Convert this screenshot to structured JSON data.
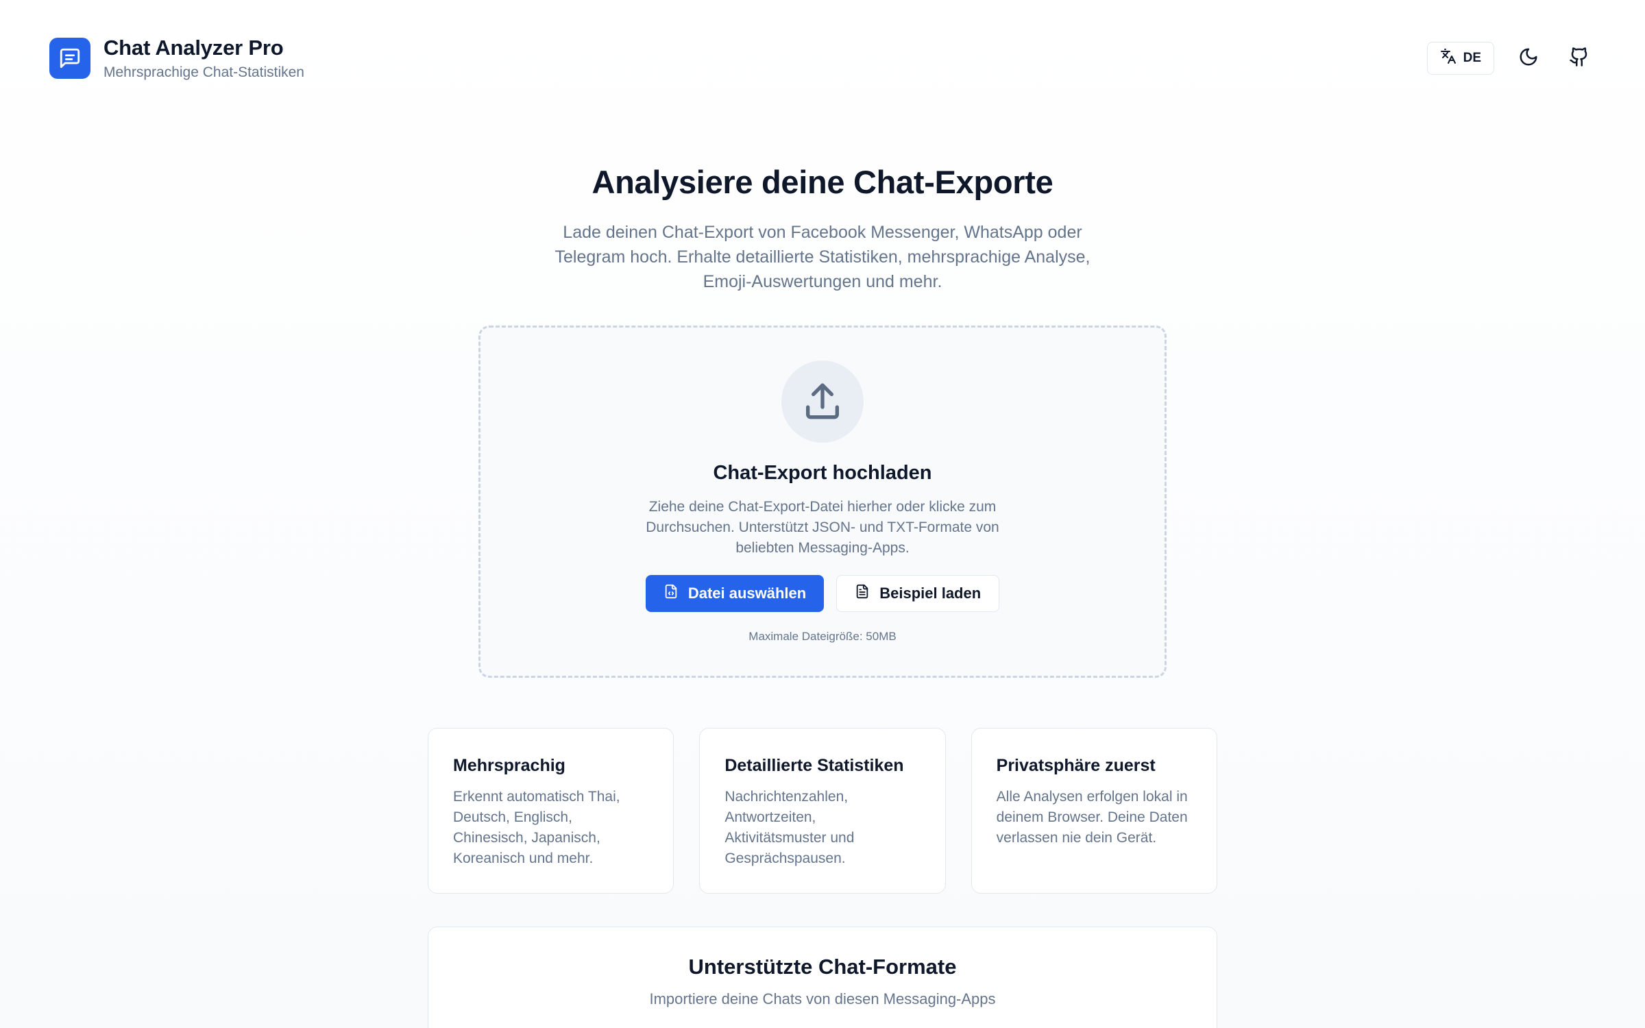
{
  "header": {
    "title": "Chat Analyzer Pro",
    "subtitle": "Mehrsprachige Chat-Statistiken",
    "language_label": "DE",
    "logo_icon": "message-square-icon",
    "language_icon": "translate-icon",
    "theme_icon": "moon-icon",
    "repo_icon": "github-icon"
  },
  "hero": {
    "title": "Analysiere deine Chat-Exporte",
    "description": "Lade deinen Chat-Export von Facebook Messenger, WhatsApp oder Telegram hoch. Erhalte detaillierte Statistiken, mehrsprachige Analyse, Emoji-Auswertungen und mehr."
  },
  "upload": {
    "icon": "upload-icon",
    "title": "Chat-Export hochladen",
    "description": "Ziehe deine Chat-Export-Datei hierher oder klicke zum Durchsuchen. Unterstützt JSON- und TXT-Formate von beliebten Messaging-Apps.",
    "choose_file_label": "Datei auswählen",
    "load_example_label": "Beispiel laden",
    "max_size_note": "Maximale Dateigröße: 50MB"
  },
  "features": [
    {
      "title": "Mehrsprachig",
      "description": "Erkennt automatisch Thai, Deutsch, Englisch, Chinesisch, Japanisch, Koreanisch und mehr."
    },
    {
      "title": "Detaillierte Statistiken",
      "description": "Nachrichtenzahlen, Antwortzeiten, Aktivitätsmuster und Gesprächspausen."
    },
    {
      "title": "Privatsphäre zuerst",
      "description": "Alle Analysen erfolgen lokal in deinem Browser. Deine Daten verlassen nie dein Gerät."
    }
  ],
  "formats": {
    "title": "Unterstützte Chat-Formate",
    "subtitle": "Importiere deine Chats von diesen Messaging-Apps"
  },
  "colors": {
    "accent": "#2563eb",
    "text": "#0f172a",
    "muted": "#64748b",
    "border": "#e2e8f0"
  }
}
